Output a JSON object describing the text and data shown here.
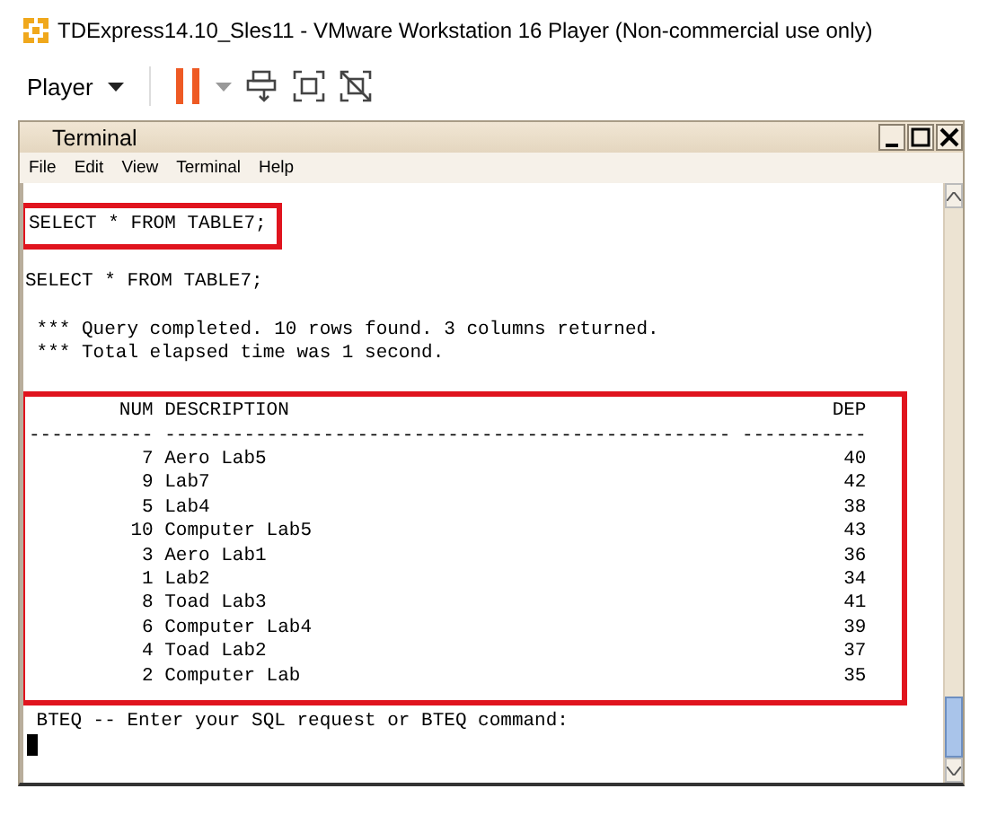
{
  "window": {
    "title": "TDExpress14.10_Sles11 - VMware Workstation 16 Player (Non-commercial use only)"
  },
  "toolbar": {
    "player_menu": "Player"
  },
  "terminal": {
    "title": "Terminal",
    "menu": [
      "File",
      "Edit",
      "View",
      "Terminal",
      "Help"
    ],
    "highlighted_command": "SELECT * FROM TABLE7;",
    "echo": "SELECT * FROM TABLE7;",
    "messages": [
      " *** Query completed. 10 rows found. 3 columns returned.",
      " *** Total elapsed time was 1 second."
    ],
    "table": {
      "columns": [
        "NUM",
        "DESCRIPTION",
        "DEP"
      ],
      "dashes": [
        "-----------",
        "--------------------------------------------------",
        "-----------"
      ],
      "rows": [
        {
          "num": "7",
          "description": "Aero Lab5",
          "dep": "40"
        },
        {
          "num": "9",
          "description": "Lab7",
          "dep": "42"
        },
        {
          "num": "5",
          "description": "Lab4",
          "dep": "38"
        },
        {
          "num": "10",
          "description": "Computer Lab5",
          "dep": "43"
        },
        {
          "num": "3",
          "description": "Aero Lab1",
          "dep": "36"
        },
        {
          "num": "1",
          "description": "Lab2",
          "dep": "34"
        },
        {
          "num": "8",
          "description": "Toad Lab3",
          "dep": "41"
        },
        {
          "num": "6",
          "description": "Computer Lab4",
          "dep": "39"
        },
        {
          "num": "4",
          "description": "Toad Lab2",
          "dep": "37"
        },
        {
          "num": "2",
          "description": "Computer Lab",
          "dep": "35"
        }
      ]
    },
    "prompt": " BTEQ -- Enter your SQL request or BTEQ command:"
  }
}
